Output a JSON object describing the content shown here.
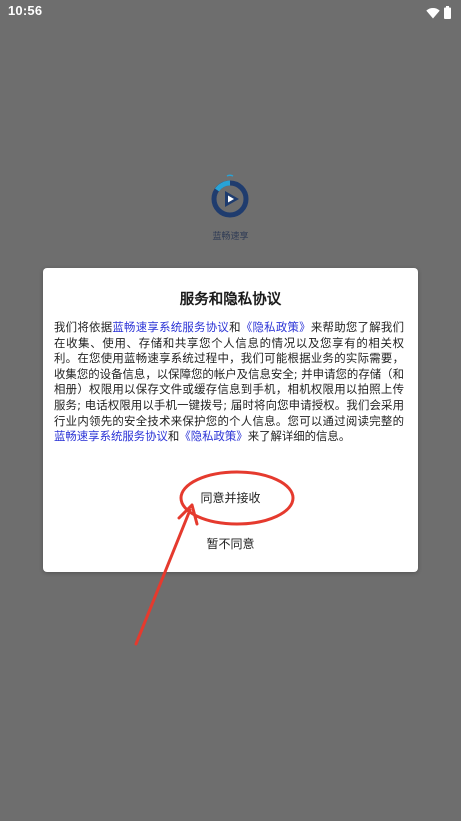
{
  "status_bar": {
    "time": "10:56",
    "icons": [
      "wifi-icon",
      "battery-icon"
    ]
  },
  "splash": {
    "app_name": "蓝畅速享",
    "brand_color": "#1f3c6e",
    "accent_color": "#29a3d6"
  },
  "dialog": {
    "title": "服务和隐私协议",
    "body": {
      "p1": "我们将依据",
      "link_service": "蓝畅速享系统服务协议",
      "p2": "和",
      "link_privacy": "《隐私政策》",
      "p3": "来帮助您了解我们在收集、使用、存储和共享您个人信息的情况以及您享有的相关权利。在您使用蓝畅速享系统过程中，我们可能根据业务的实际需要，收集您的设备信息，以保障您的帐户及信息安全; 并申请您的存储（和相册）权限用以保存文件或缓存信息到手机，相机权限用以拍照上传服务; 电话权限用以手机一键拨号; 届时将向您申请授权。我们会采用行业内领先的安全技术来保护您的个人信息。您可以通过阅读完整的",
      "link_service_2": "蓝畅速享系统服务协议",
      "p4": "和",
      "link_privacy_2": "《隐私政策》",
      "p5": "来了解详细的信息。"
    },
    "agree_label": "同意并接收",
    "disagree_label": "暂不同意",
    "link_color": "#2b33d6"
  },
  "annotation": {
    "color": "#e53a2e"
  }
}
